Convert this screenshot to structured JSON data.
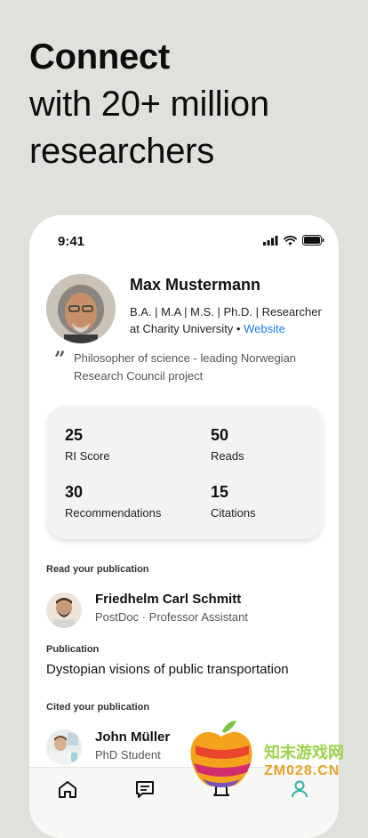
{
  "headline": {
    "line1": "Connect",
    "line2": "with 20+ million",
    "line3": "researchers"
  },
  "status_bar": {
    "time": "9:41"
  },
  "profile": {
    "name": "Max Mustermann",
    "degrees": "B.A. | M.A | M.S. | Ph.D. | Researcher at Charity University",
    "separator": " • ",
    "website_label": "Website",
    "quote": "Philosopher of science - leading Norwegian Research Council project"
  },
  "stats": [
    {
      "value": "25",
      "label": "RI Score"
    },
    {
      "value": "50",
      "label": "Reads"
    },
    {
      "value": "30",
      "label": "Recommendations"
    },
    {
      "value": "15",
      "label": "Citations"
    }
  ],
  "read_section": {
    "title": "Read your publication",
    "person_name": "Friedhelm Carl Schmitt",
    "person_role": "PostDoc · Professor Assistant"
  },
  "publication_section": {
    "title": "Publication",
    "publication_title": "Dystopian visions of public transportation"
  },
  "cited_section": {
    "title": "Cited your publication",
    "person_name": "John Müller",
    "person_role": "PhD Student"
  },
  "tab_bar": {
    "icons": [
      "home-icon",
      "messages-icon",
      "notifications-icon",
      "profile-icon"
    ],
    "active": "profile-icon",
    "active_color": "#2bb3a3"
  },
  "watermark": {
    "line1": "知末游戏网",
    "line2": "ZM028.CN"
  }
}
